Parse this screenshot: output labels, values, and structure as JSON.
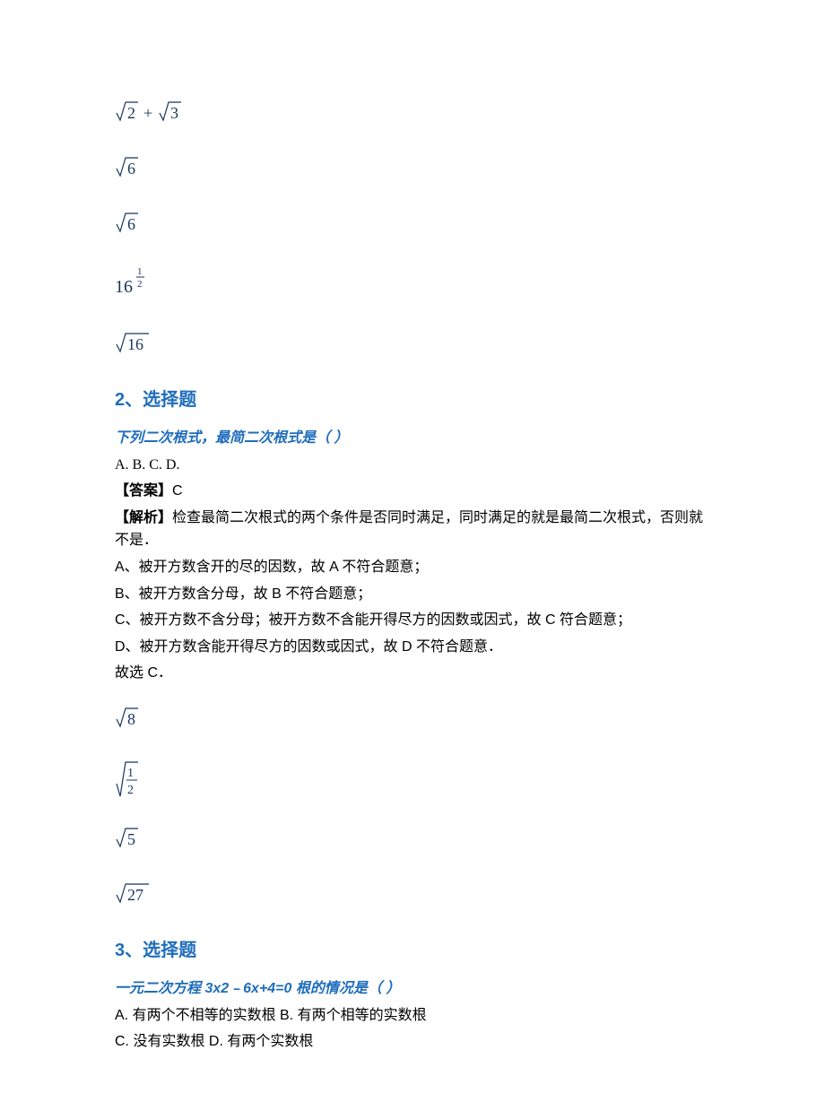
{
  "q1": {
    "math1_alt": "√2 + √3",
    "math2_alt": "√6",
    "math3_alt": "√6",
    "math4_alt": "16^(1/2)",
    "math5_alt": "√16"
  },
  "q2": {
    "heading": "2、选择题",
    "stem": "下列二次根式，最简二次根式是（ ）",
    "options": "A.  B.  C.  D.",
    "answer_label": "【答案】",
    "answer_value": "C",
    "analysis_label": "【解析】",
    "analysis_text": "检查最简二次根式的两个条件是否同时满足，同时满足的就是最简二次根式，否则就不是．",
    "lineA": "A、被开方数含开的尽的因数，故 A 不符合题意；",
    "lineB": "B、被开方数含分母，故 B 不符合题意；",
    "lineC": "C、被开方数不含分母；被开方数不含能开得尽方的因数或因式，故 C 符合题意；",
    "lineD": "D、被开方数含能开得尽方的因数或因式，故 D 不符合题意．",
    "conclusion": "故选 C．",
    "math1_alt": "√8",
    "math2_alt": "√(1/2)",
    "math3_alt": "√5",
    "math4_alt": "√27"
  },
  "q3": {
    "heading": "3、选择题",
    "stem": "一元二次方程 3x2﹣6x+4=0 根的情况是（ ）",
    "options_line1": "A. 有两个不相等的实数根 B. 有两个相等的实数根",
    "options_line2": "C. 没有实数根 D. 有两个实数根"
  }
}
